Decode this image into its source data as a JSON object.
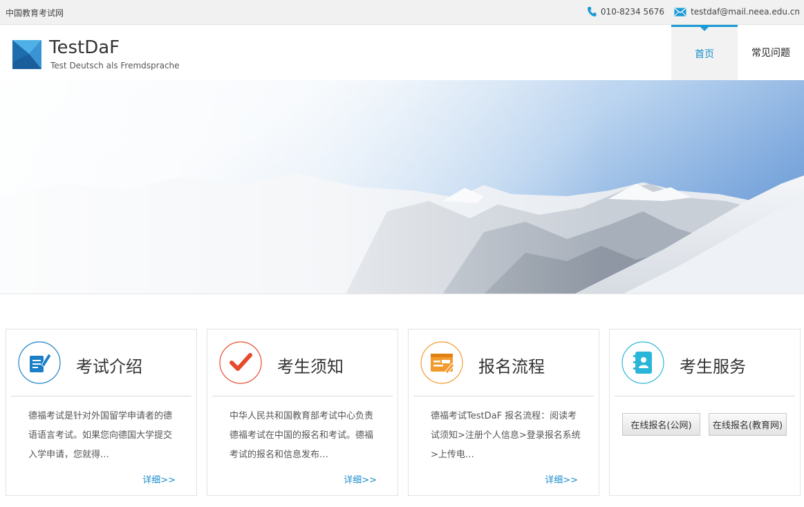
{
  "topbar": {
    "site_name": "中国教育考试网",
    "phone": "010-8234 5676",
    "email": "testdaf@mail.neea.edu.cn",
    "icons": [
      "phone-icon",
      "mail-icon"
    ]
  },
  "header": {
    "brand": "TestDaF",
    "brand_subtitle": "Test Deutsch als Fremdsprache",
    "nav": [
      {
        "label": "首页",
        "active": true
      },
      {
        "label": "常见问题",
        "active": false
      }
    ]
  },
  "colors": {
    "accent": "#1a9ad6",
    "card1": "#1a7fc8",
    "card2": "#e64a2a",
    "card3": "#f29a2e",
    "card4": "#29b6d8"
  },
  "cards": [
    {
      "title": "考试介绍",
      "icon": "document-pen-icon",
      "desc": "德福考试是针对外国留学申请者的德语语言考试。如果您向德国大学提交入学申请，您就得…",
      "more": "详细>>"
    },
    {
      "title": "考生须知",
      "icon": "checkmark-icon",
      "desc": "中华人民共和国教育部考试中心负责德福考试在中国的报名和考试。德福考试的报名和信息发布…",
      "more": "详细>>"
    },
    {
      "title": "报名流程",
      "icon": "form-icon",
      "desc": "德福考试TestDaF 报名流程：阅读考试须知>注册个人信息>登录报名系统>上传电…",
      "more": "详细>>"
    },
    {
      "title": "考生服务",
      "icon": "contact-book-icon",
      "buttons": [
        "在线报名(公网)",
        "在线报名(教育网)"
      ]
    }
  ]
}
